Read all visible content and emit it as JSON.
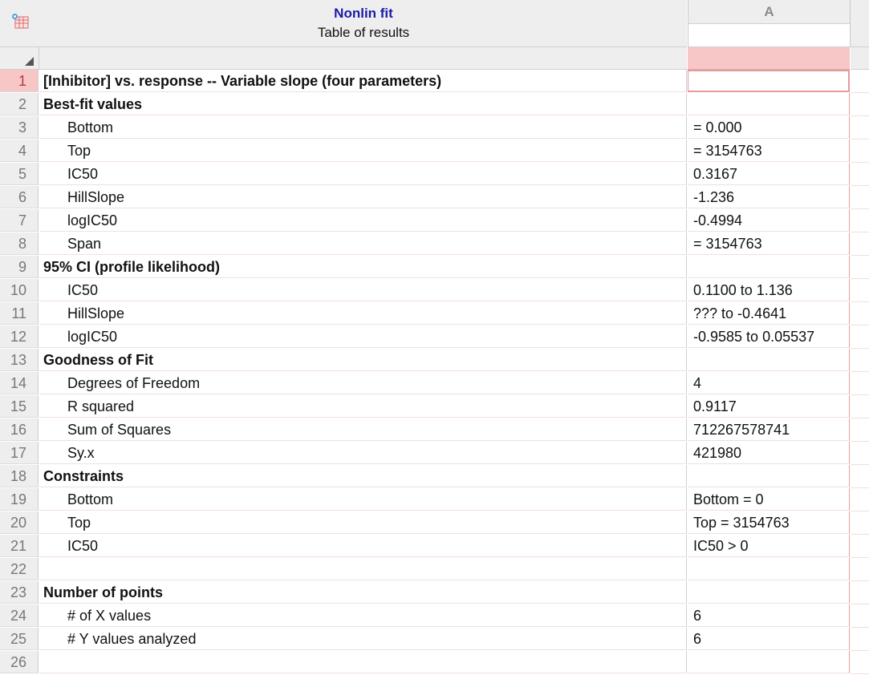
{
  "header": {
    "title": "Nonlin fit",
    "subtitle": "Table of results",
    "column_label": "A",
    "icon": "results-table-icon"
  },
  "colors": {
    "title_blue": "#1a1aa8",
    "selection_pink": "#f7c6c6",
    "header_gray": "#eeeeee"
  },
  "rows": [
    {
      "num": "1",
      "label": "[Inhibitor] vs. response -- Variable slope (four parameters)",
      "value": "",
      "kind": "head"
    },
    {
      "num": "2",
      "label": "Best-fit values",
      "value": "",
      "kind": "head"
    },
    {
      "num": "3",
      "label": "Bottom",
      "value": "= 0.000",
      "kind": "sub"
    },
    {
      "num": "4",
      "label": "Top",
      "value": "= 3154763",
      "kind": "sub"
    },
    {
      "num": "5",
      "label": "IC50",
      "value": "0.3167",
      "kind": "sub"
    },
    {
      "num": "6",
      "label": "HillSlope",
      "value": "-1.236",
      "kind": "sub"
    },
    {
      "num": "7",
      "label": "logIC50",
      "value": "-0.4994",
      "kind": "sub"
    },
    {
      "num": "8",
      "label": "Span",
      "value": "= 3154763",
      "kind": "sub"
    },
    {
      "num": "9",
      "label": "95% CI (profile likelihood)",
      "value": "",
      "kind": "head"
    },
    {
      "num": "10",
      "label": "IC50",
      "value": "0.1100 to 1.136",
      "kind": "sub"
    },
    {
      "num": "11",
      "label": "HillSlope",
      "value": "??? to -0.4641",
      "kind": "sub"
    },
    {
      "num": "12",
      "label": "logIC50",
      "value": "-0.9585 to 0.05537",
      "kind": "sub"
    },
    {
      "num": "13",
      "label": "Goodness of Fit",
      "value": "",
      "kind": "head"
    },
    {
      "num": "14",
      "label": "Degrees of Freedom",
      "value": "4",
      "kind": "sub"
    },
    {
      "num": "15",
      "label": "R squared",
      "value": "0.9117",
      "kind": "sub"
    },
    {
      "num": "16",
      "label": "Sum of Squares",
      "value": "712267578741",
      "kind": "sub"
    },
    {
      "num": "17",
      "label": "Sy.x",
      "value": "421980",
      "kind": "sub"
    },
    {
      "num": "18",
      "label": "Constraints",
      "value": "",
      "kind": "head"
    },
    {
      "num": "19",
      "label": "Bottom",
      "value": "Bottom = 0",
      "kind": "sub"
    },
    {
      "num": "20",
      "label": "Top",
      "value": "Top = 3154763",
      "kind": "sub"
    },
    {
      "num": "21",
      "label": "IC50",
      "value": "IC50 > 0",
      "kind": "sub"
    },
    {
      "num": "22",
      "label": "",
      "value": "",
      "kind": "sub"
    },
    {
      "num": "23",
      "label": "Number of points",
      "value": "",
      "kind": "head"
    },
    {
      "num": "24",
      "label": "# of X values",
      "value": "6",
      "kind": "sub"
    },
    {
      "num": "25",
      "label": "# Y values analyzed",
      "value": "6",
      "kind": "sub"
    },
    {
      "num": "26",
      "label": "",
      "value": "",
      "kind": "sub"
    }
  ],
  "selection": {
    "row": "1",
    "column": "A"
  }
}
